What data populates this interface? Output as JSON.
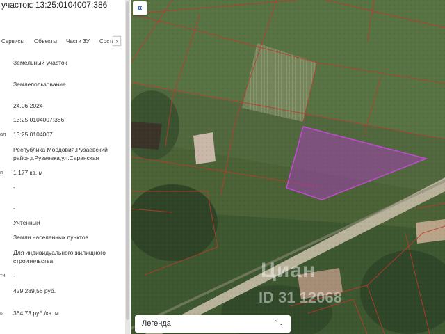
{
  "panel": {
    "title": "участок: 13:25:0104007:386",
    "tabs": [
      "Сервисы",
      "Объекты",
      "Части ЗУ",
      "Соста"
    ],
    "tab_next_icon": "chevron-right-icon",
    "rows": [
      {
        "label": "",
        "value": "Земельный участок"
      },
      {
        "label": "",
        "value": "Землепользование"
      },
      {
        "label": "",
        "value": "24.06.2024"
      },
      {
        "label": "",
        "value": "13:25:0104007:386"
      },
      {
        "label": "ал",
        "value": "13:25:0104007"
      },
      {
        "label": "",
        "value": "Республика Мордовия,Рузаевский район,г.Рузаевка,ул.Саранская"
      },
      {
        "label": "я",
        "value": "1 177 кв. м"
      },
      {
        "label": "",
        "value": "-"
      },
      {
        "label": "",
        "value": "-"
      },
      {
        "label": "",
        "value": "Учтенный"
      },
      {
        "label": "",
        "value": "Земли населенных пунктов"
      },
      {
        "label": "",
        "value": "Для индивидуального жилищного строительства"
      },
      {
        "label": "ти",
        "value": "-"
      },
      {
        "label": "",
        "value": "429 289,56 руб."
      },
      {
        "label": "ь",
        "value": "364,73 руб./кв. м"
      }
    ]
  },
  "map": {
    "collapse_icon": "double-chevron-left-icon",
    "collapse_label": "«",
    "legend_label": "Легенда",
    "legend_icon": "chevron-up-down-icon",
    "legend_chevron": "⌃⌄",
    "watermark": "Циан",
    "watermark_id": "ID 31 12068",
    "colors": {
      "parcel_border": "#c0392b",
      "selected_fill": "#a23fb0",
      "road": "#b9b39c"
    }
  }
}
